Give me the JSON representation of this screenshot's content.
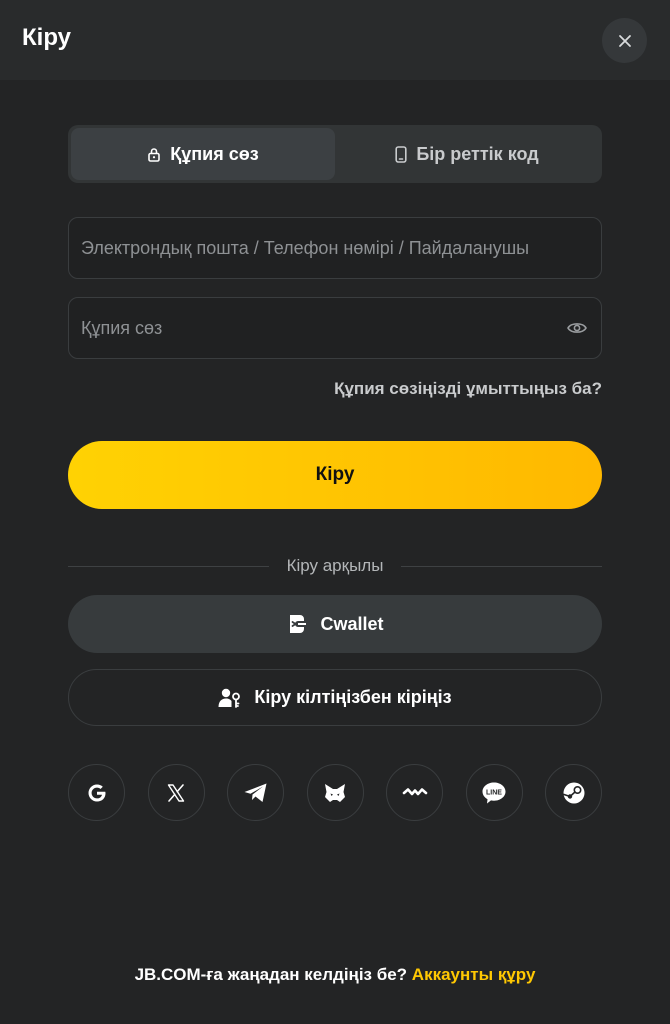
{
  "header": {
    "title": "Кіру",
    "close_icon": "close-icon"
  },
  "tabs": [
    {
      "label": "Құпия сөз",
      "icon": "lock-icon",
      "active": true
    },
    {
      "label": "Бір реттік код",
      "icon": "phone-icon",
      "active": false
    }
  ],
  "form": {
    "identifier_placeholder": "Электрондық пошта / Телефон нөмірі / Пайдаланушы",
    "password_placeholder": "Құпия сөз",
    "forgot_link": "Құпия сөзіңізді ұмыттыңыз ба?",
    "submit_label": "Кіру"
  },
  "alt_login": {
    "divider_label": "Кіру арқылы",
    "cwallet_label": "Cwallet",
    "passkey_label": "Кіру кілтіңізбен кіріңіз"
  },
  "socials": [
    "google-icon",
    "x-icon",
    "telegram-icon",
    "metamask-icon",
    "walletconnect-icon",
    "line-icon",
    "steam-icon"
  ],
  "footer": {
    "question": "JB.COM-ға жаңадан келдіңіз бе?",
    "signup_link": "Аккаунты құру"
  },
  "colors": {
    "accent": "#ffc802",
    "background": "#232425"
  }
}
